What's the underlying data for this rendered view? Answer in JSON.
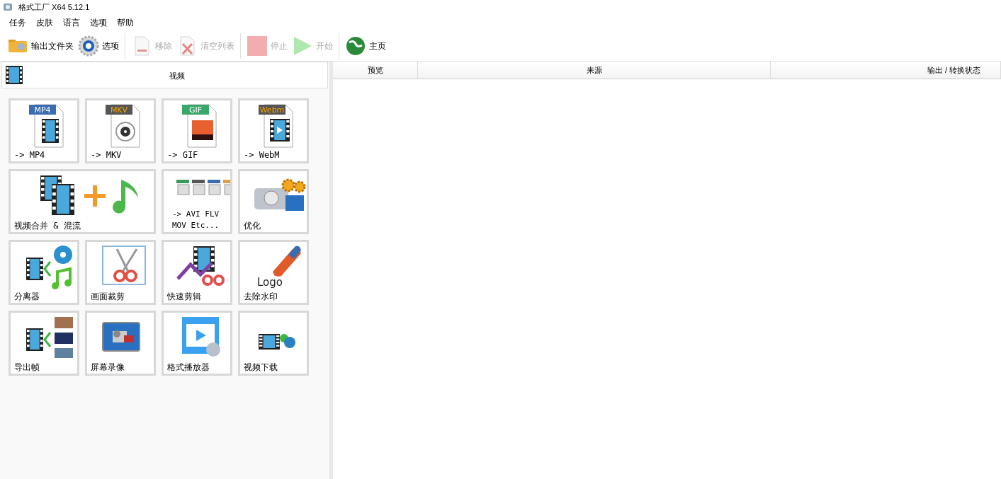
{
  "window": {
    "title": "格式工厂 X64 5.12.1"
  },
  "menu": [
    "任务",
    "皮肤",
    "语言",
    "选项",
    "帮助"
  ],
  "toolbar": [
    {
      "kind": "folder",
      "label": "输出文件夹",
      "disabled": false
    },
    {
      "kind": "gear",
      "label": "选项",
      "disabled": false
    },
    {
      "kind": "separator"
    },
    {
      "kind": "remove",
      "label": "移除",
      "disabled": true
    },
    {
      "kind": "clear",
      "label": "清空列表",
      "disabled": true
    },
    {
      "kind": "separator"
    },
    {
      "kind": "stop",
      "label": "停止",
      "disabled": true
    },
    {
      "kind": "start",
      "label": "开始",
      "disabled": true
    },
    {
      "kind": "separator"
    },
    {
      "kind": "globe",
      "label": "主页",
      "disabled": false
    }
  ],
  "panel": {
    "title": "视频",
    "tiles": [
      {
        "kind": "file",
        "badge": "MP4",
        "color": "#3a6db0",
        "label": "-> MP4"
      },
      {
        "kind": "file-disc",
        "badge": "MKV",
        "color": "#555555",
        "label": "-> MKV"
      },
      {
        "kind": "file-photo",
        "badge": "GIF",
        "color": "#3aa86a",
        "label": "-> GIF"
      },
      {
        "kind": "file-play",
        "badge": "Webm",
        "color": "#555555",
        "label": "-> WebM"
      },
      {
        "kind": "merge",
        "label": "视频合并 & 混流",
        "wide": true
      },
      {
        "kind": "multi",
        "label": "-> AVI FLV\nMOV Etc..."
      },
      {
        "kind": "optimize",
        "label": "优化"
      },
      {
        "kind": "splitter",
        "label": "分离器"
      },
      {
        "kind": "crop",
        "label": "画面裁剪"
      },
      {
        "kind": "quickcut",
        "label": "快速剪辑"
      },
      {
        "kind": "watermark",
        "badge": "Logo",
        "label": "去除水印"
      },
      {
        "kind": "frames",
        "label": "导出帧"
      },
      {
        "kind": "record",
        "label": "屏幕录像"
      },
      {
        "kind": "player",
        "label": "格式播放器"
      },
      {
        "kind": "download",
        "label": "视频下载"
      }
    ]
  },
  "table": {
    "columns": [
      "预览",
      "来源",
      "输出 / 转换状态"
    ]
  }
}
